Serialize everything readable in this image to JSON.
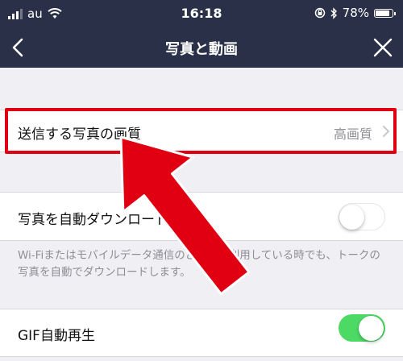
{
  "status_bar": {
    "carrier": "au",
    "time": "16:18",
    "battery_percent": "78%"
  },
  "nav": {
    "title": "写真と動画"
  },
  "settings": {
    "photo_quality": {
      "label": "送信する写真の画質",
      "value": "高画質"
    },
    "auto_download": {
      "label": "写真を自動ダウンロード",
      "enabled": false,
      "description": "Wi-Fiまたはモバイルデータ通信のどちらを利用している時でも、トークの写真を自動でダウンロードします。"
    },
    "gif_autoplay": {
      "label": "GIF自動再生",
      "enabled": true
    }
  },
  "colors": {
    "nav_background": "#293048",
    "highlight_border": "#e00012",
    "arrow": "#e00012",
    "toggle_on": "#4cd964"
  },
  "icons": [
    "signal-icon",
    "wifi-icon",
    "orientation-lock-icon",
    "bluetooth-icon",
    "battery-icon",
    "back-icon",
    "close-icon",
    "chevron-right-icon"
  ]
}
